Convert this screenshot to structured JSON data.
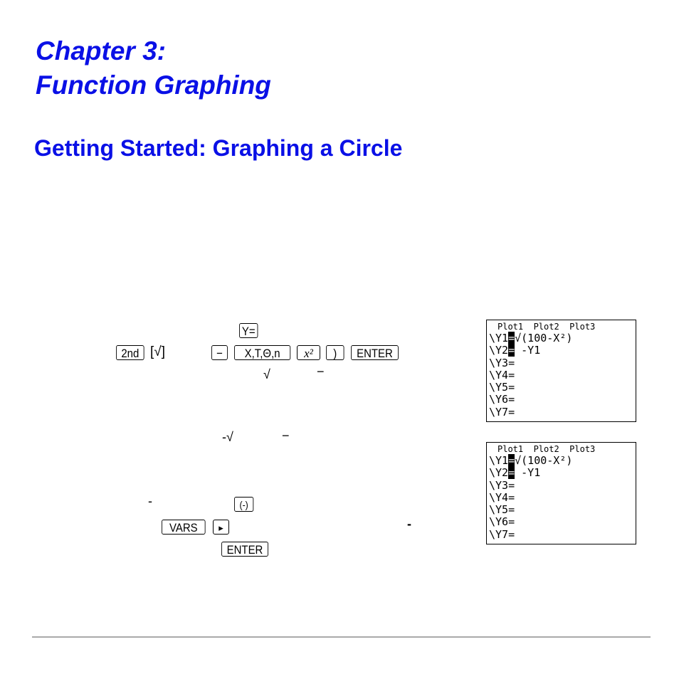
{
  "chapter": {
    "line1": "Chapter 3:",
    "line2": "Function Graphing"
  },
  "section_title": "Getting Started: Graphing a Circle",
  "keys": {
    "y_equals": "Y=",
    "second": "2nd",
    "sqrt_bracket": "[√]",
    "minus": "−",
    "xt_theta_n": "X,T,Θ,n",
    "x_squared": "x²",
    "close_paren": ")",
    "enter": "ENTER",
    "negative": "(-)",
    "vars": "VARS",
    "right_arrow": "▸",
    "enter2": "ENTER"
  },
  "inline_symbols": {
    "sqrt1": "√",
    "minus1": "−",
    "neg_sqrt": "-√",
    "minus2": "−",
    "dash1": "-",
    "dash2": "-"
  },
  "screens": [
    {
      "header": "Plot1  Plot2  Plot3",
      "lines": [
        {
          "label": "\\Y1",
          "eq": "=",
          "selected": true,
          "expr": "√(100-X²)"
        },
        {
          "label": "\\Y2",
          "eq": "=",
          "selected": true,
          "expr": " -Y1"
        },
        {
          "label": "\\Y3",
          "eq": "=",
          "selected": false,
          "expr": ""
        },
        {
          "label": "\\Y4",
          "eq": "=",
          "selected": false,
          "expr": ""
        },
        {
          "label": "\\Y5",
          "eq": "=",
          "selected": false,
          "expr": ""
        },
        {
          "label": "\\Y6",
          "eq": "=",
          "selected": false,
          "expr": ""
        },
        {
          "label": "\\Y7",
          "eq": "=",
          "selected": false,
          "expr": ""
        }
      ]
    },
    {
      "header": "Plot1  Plot2  Plot3",
      "lines": [
        {
          "label": "\\Y1",
          "eq": "=",
          "selected": true,
          "expr": "√(100-X²)"
        },
        {
          "label": "\\Y2",
          "eq": "=",
          "selected": true,
          "expr": " -Y1"
        },
        {
          "label": "\\Y3",
          "eq": "=",
          "selected": false,
          "expr": ""
        },
        {
          "label": "\\Y4",
          "eq": "=",
          "selected": false,
          "expr": ""
        },
        {
          "label": "\\Y5",
          "eq": "=",
          "selected": false,
          "expr": ""
        },
        {
          "label": "\\Y6",
          "eq": "=",
          "selected": false,
          "expr": ""
        },
        {
          "label": "\\Y7",
          "eq": "=",
          "selected": false,
          "expr": ""
        }
      ]
    }
  ]
}
